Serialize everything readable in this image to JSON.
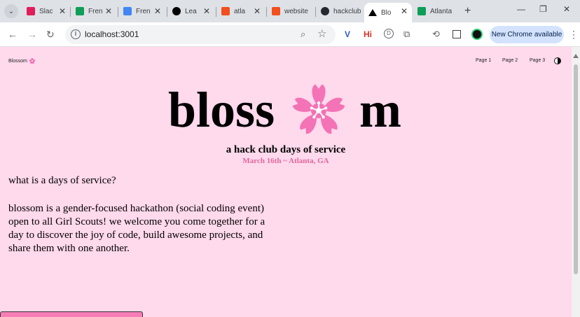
{
  "browser": {
    "tabs": [
      {
        "label": "Slac",
        "favicon_color": "#e01e5a"
      },
      {
        "label": "Fren",
        "favicon_color": "#0f9d58"
      },
      {
        "label": "Fren",
        "favicon_color": "#4285f4"
      },
      {
        "label": "Lea",
        "favicon_color": "#000000"
      },
      {
        "label": "atla",
        "favicon_color": "#f24e1e"
      },
      {
        "label": "website",
        "favicon_color": "#f24e1e"
      },
      {
        "label": "hackclub",
        "favicon_color": "#24292f"
      },
      {
        "label": "Blo",
        "favicon_color": "#000000",
        "active": true
      },
      {
        "label": "Atlanta",
        "favicon_color": "#0f9d58"
      }
    ],
    "url": "localhost:3001",
    "new_chrome_label": "New Chrome available",
    "extensions": [
      "V",
      "Hi",
      "D",
      "puzzle",
      "ext",
      "panel",
      "avatar"
    ]
  },
  "site": {
    "brand": "Blossom",
    "nav": [
      "Page 1",
      "Page 2",
      "Page 3"
    ],
    "title_left": "bloss",
    "title_right": "m",
    "tagline": "a hack club days of service",
    "dateline": "March 16th ~ Atlanta, GA",
    "question": "what is a days of service?",
    "body": "blossom is a gender-focused hackathon (social coding event) open to all Girl Scouts! we welcome you come together for a day to discover the joy of code, build awesome projects, and share them with one another.",
    "accent": "#f472b6",
    "background": "#ffd9ec"
  }
}
